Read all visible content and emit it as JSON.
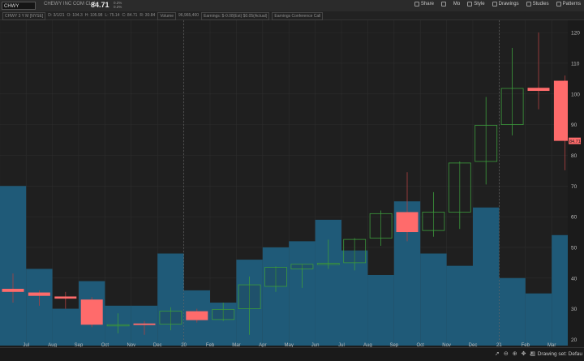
{
  "header": {
    "symbol": "CHWY",
    "company": "CHEWY INC COM CL A",
    "last_price": "84.71",
    "mini_change": [
      "0.2%",
      "0.2%"
    ],
    "toolbar": [
      {
        "label": "Share",
        "icon": "share-icon"
      },
      {
        "label": "",
        "icon": "menu-icon"
      },
      {
        "label": "Mo",
        "icon": ""
      },
      {
        "label": "Style",
        "icon": "style-icon"
      },
      {
        "label": "Drawings",
        "icon": "drawings-icon"
      },
      {
        "label": "Studies",
        "icon": "studies-icon"
      },
      {
        "label": "Patterns",
        "icon": "patterns-icon"
      }
    ]
  },
  "status_bar": {
    "period": "CHWY 3 Y M [NYSE]",
    "date": "D: 3/1/21",
    "open": "O: 104.3",
    "high": "H: 105.98",
    "low": "L: 75.14",
    "close": "C: 84.71",
    "range": "R: 30.84",
    "volume_label": "Volume",
    "volume": "96,965,400",
    "earnings": "Earnings: $-0.08(Est) $0.05(Actual)",
    "conference": "Earnings Conference Call"
  },
  "price_label": "84.71",
  "bottom": {
    "drawing_set": "Drawing set: Defau"
  },
  "chart_data": {
    "type": "candlestick",
    "title": "CHWY 3 Y M [NYSE]",
    "ylim": [
      18,
      124
    ],
    "y_ticks": [
      20,
      30,
      40,
      50,
      60,
      70,
      80,
      90,
      100,
      110,
      120
    ],
    "x_tick_labels": [
      "Jul",
      "Aug",
      "Sep",
      "Oct",
      "Nov",
      "Dec",
      "20",
      "Feb",
      "Mar",
      "Apr",
      "May",
      "Jun",
      "Jul",
      "Aug",
      "Sep",
      "Oct",
      "Nov",
      "Dec",
      "21",
      "Feb",
      "Mar"
    ],
    "year_separators": [
      "20",
      "21"
    ],
    "candles": [
      {
        "month": "Jun 2019",
        "open": 36.5,
        "high": 41.5,
        "low": 32,
        "close": 35.5
      },
      {
        "month": "Jul 2019",
        "open": 35.3,
        "high": 36,
        "low": 31,
        "close": 34.2
      },
      {
        "month": "Aug 2019",
        "open": 34,
        "high": 35.5,
        "low": 30,
        "close": 33.3
      },
      {
        "month": "Sep 2019",
        "open": 33,
        "high": 33.8,
        "low": 24,
        "close": 24.8
      },
      {
        "month": "Oct 2019",
        "open": 24.8,
        "high": 28.5,
        "low": 22,
        "close": 24.8
      },
      {
        "month": "Nov 2019",
        "open": 25.2,
        "high": 26,
        "low": 21.5,
        "close": 24.7
      },
      {
        "month": "Dec 2019",
        "open": 25,
        "high": 30.5,
        "low": 23,
        "close": 29.2
      },
      {
        "month": "Jan 2020",
        "open": 29.2,
        "high": 30,
        "low": 25.5,
        "close": 26.3
      },
      {
        "month": "Feb 2020",
        "open": 26.5,
        "high": 32,
        "low": 26,
        "close": 29.8
      },
      {
        "month": "Mar 2020",
        "open": 30,
        "high": 40.5,
        "low": 21.5,
        "close": 37.8
      },
      {
        "month": "Apr 2020",
        "open": 37.3,
        "high": 43.8,
        "low": 35.5,
        "close": 43.5
      },
      {
        "month": "May 2020",
        "open": 43,
        "high": 44.5,
        "low": 36.8,
        "close": 44.5
      },
      {
        "month": "Jun 2020",
        "open": 44.8,
        "high": 52.5,
        "low": 43,
        "close": 44.8
      },
      {
        "month": "Jul 2020",
        "open": 45,
        "high": 53,
        "low": 42.5,
        "close": 52.6
      },
      {
        "month": "Aug 2020",
        "open": 53,
        "high": 62,
        "low": 50.5,
        "close": 61
      },
      {
        "month": "Sep 2020",
        "open": 61.5,
        "high": 74.5,
        "low": 52,
        "close": 55
      },
      {
        "month": "Oct 2020",
        "open": 55.5,
        "high": 68,
        "low": 53.5,
        "close": 61.5
      },
      {
        "month": "Nov 2020",
        "open": 61.5,
        "high": 78,
        "low": 56,
        "close": 77.5
      },
      {
        "month": "Dec 2020",
        "open": 78,
        "high": 99,
        "low": 70.5,
        "close": 89.8
      },
      {
        "month": "Jan 2021",
        "open": 90,
        "high": 115,
        "low": 86.5,
        "close": 101.8
      },
      {
        "month": "Feb 2021",
        "open": 102,
        "high": 120,
        "low": 95,
        "close": 101
      },
      {
        "month": "Mar 2021",
        "open": 104.3,
        "high": 105.98,
        "low": 75.14,
        "close": 84.71
      }
    ],
    "volume": [
      70,
      43,
      30,
      39,
      31,
      31,
      48,
      36,
      32,
      46,
      50,
      52,
      59,
      49,
      41,
      65,
      48,
      44,
      63,
      40,
      35,
      54
    ],
    "colors": {
      "up": "#3c9b3c",
      "down": "#ff6b6b",
      "volume": "#1f5a78",
      "background": "#1f1f1f",
      "grid": "#2d2d2d"
    }
  }
}
